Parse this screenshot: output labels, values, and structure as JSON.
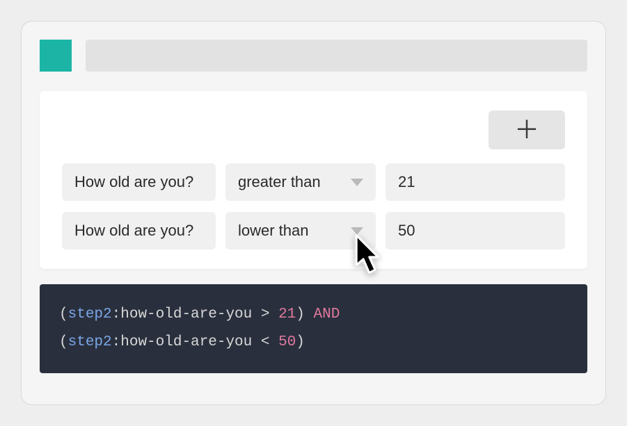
{
  "rules": [
    {
      "question_label": "How old are you?",
      "operator_label": "greater than",
      "value": "21"
    },
    {
      "question_label": "How old are you?",
      "operator_label": "lower than",
      "value": "50"
    }
  ],
  "code": {
    "line1": {
      "paren_open": "(",
      "step": "step2",
      "colon": ":",
      "field": "how-old-are-you",
      "op": " > ",
      "num": "21",
      "paren_close": ") ",
      "and": "AND"
    },
    "line2": {
      "paren_open": "(",
      "step": "step2",
      "colon": ":",
      "field": "how-old-are-you",
      "op": " < ",
      "num": "50",
      "paren_close": ")"
    }
  }
}
